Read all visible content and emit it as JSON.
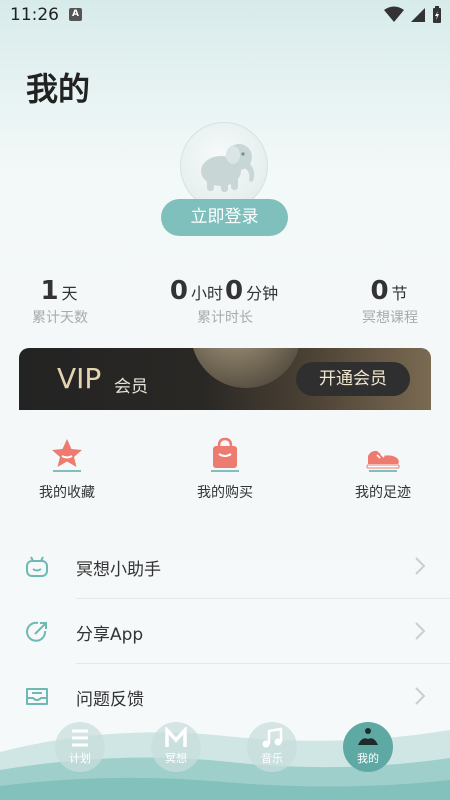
{
  "status_bar": {
    "time": "11:26",
    "a_badge": "A"
  },
  "page_title": "我的",
  "login_button": "立即登录",
  "stats": {
    "days": {
      "value": "1",
      "unit": "天",
      "label": "累计天数"
    },
    "duration": {
      "hours": "0",
      "hours_unit": "小时",
      "minutes": "0",
      "minutes_unit": "分钟",
      "label": "累计时长"
    },
    "courses": {
      "value": "0",
      "unit": "节",
      "label": "冥想课程"
    }
  },
  "vip": {
    "title": "VIP",
    "subtitle": "会员",
    "button": "开通会员"
  },
  "quick_actions": [
    {
      "label": "我的收藏",
      "icon": "star-icon"
    },
    {
      "label": "我的购买",
      "icon": "shopping-bag-icon"
    },
    {
      "label": "我的足迹",
      "icon": "shoe-icon"
    }
  ],
  "menu": [
    {
      "label": "冥想小助手",
      "icon": "robot-icon"
    },
    {
      "label": "分享App",
      "icon": "share-icon"
    },
    {
      "label": "问题反馈",
      "icon": "feedback-icon"
    }
  ],
  "tabs": [
    {
      "label": "计划",
      "icon": "list-icon"
    },
    {
      "label": "冥想",
      "icon": "m-icon"
    },
    {
      "label": "音乐",
      "icon": "music-note-icon"
    },
    {
      "label": "我的",
      "icon": "meditation-icon",
      "active": true
    }
  ],
  "colors": {
    "accent": "#7fc0bd",
    "tab_active": "#5fa9a4",
    "icon_coral": "#ee7b70",
    "vip_gold": "#e7d3b0"
  }
}
